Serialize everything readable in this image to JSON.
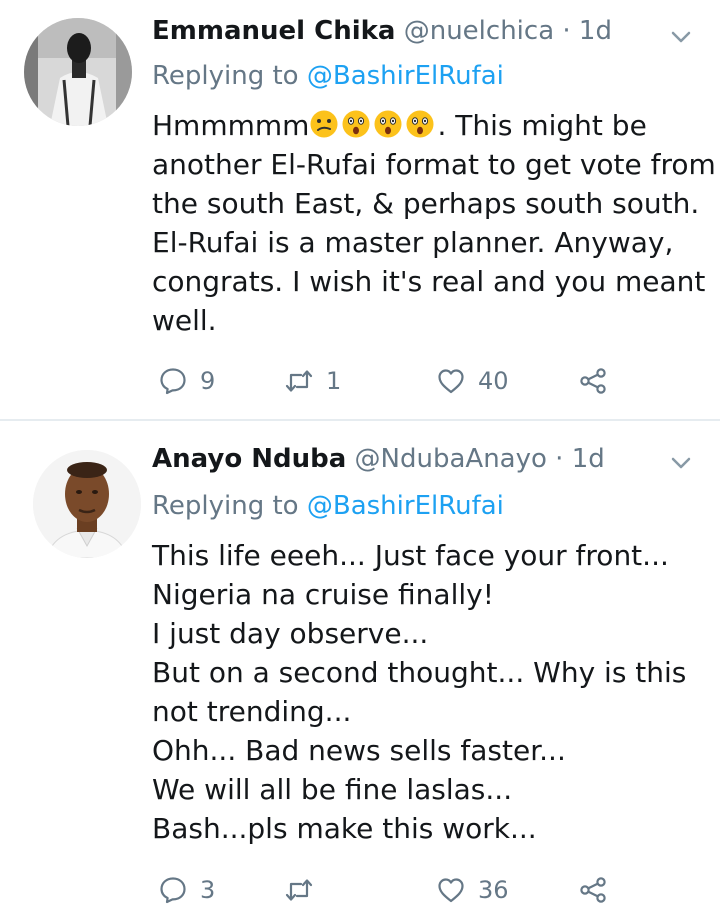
{
  "tweets": [
    {
      "name": "Emmanuel Chika",
      "handle": "@nuelchica",
      "separator": "·",
      "time": "1d",
      "replying_prefix": "Replying to",
      "replying_to": "@BashirElRufai",
      "text_first": "Hmmmmm",
      "emojis": [
        "confused-face",
        "astonished-face",
        "astonished-face",
        "astonished-face"
      ],
      "text_after_emoji": ". This might be",
      "lines": [
        "another El-Rufai format to get vote from",
        "the south East, & perhaps south south.",
        "El-Rufai is a master planner. Anyway,",
        "congrats.  I wish it's real and you meant",
        "well."
      ],
      "replies": "9",
      "retweets": "1",
      "likes": "40"
    },
    {
      "name": "Anayo Nduba",
      "handle": "@NdubaAnayo",
      "separator": "·",
      "time": "1d",
      "replying_prefix": "Replying to",
      "replying_to": "@BashirElRufai",
      "lines": [
        "This life eeeh... Just face your front...",
        "Nigeria na cruise finally!",
        "I just day observe...",
        "But on a second thought... Why is this",
        "not trending...",
        "Ohh... Bad news sells faster...",
        "We will all be fine laslas...",
        "Bash...pls make this work..."
      ],
      "replies": "3",
      "retweets": "",
      "likes": "36"
    }
  ],
  "icons": {
    "reply": "reply-icon",
    "retweet": "retweet-icon",
    "like": "heart-icon",
    "share": "share-icon",
    "menu": "chevron-down-icon"
  },
  "colors": {
    "text": "#14171a",
    "secondary": "#657786",
    "link": "#1da1f2",
    "divider": "#e6ecf0"
  }
}
